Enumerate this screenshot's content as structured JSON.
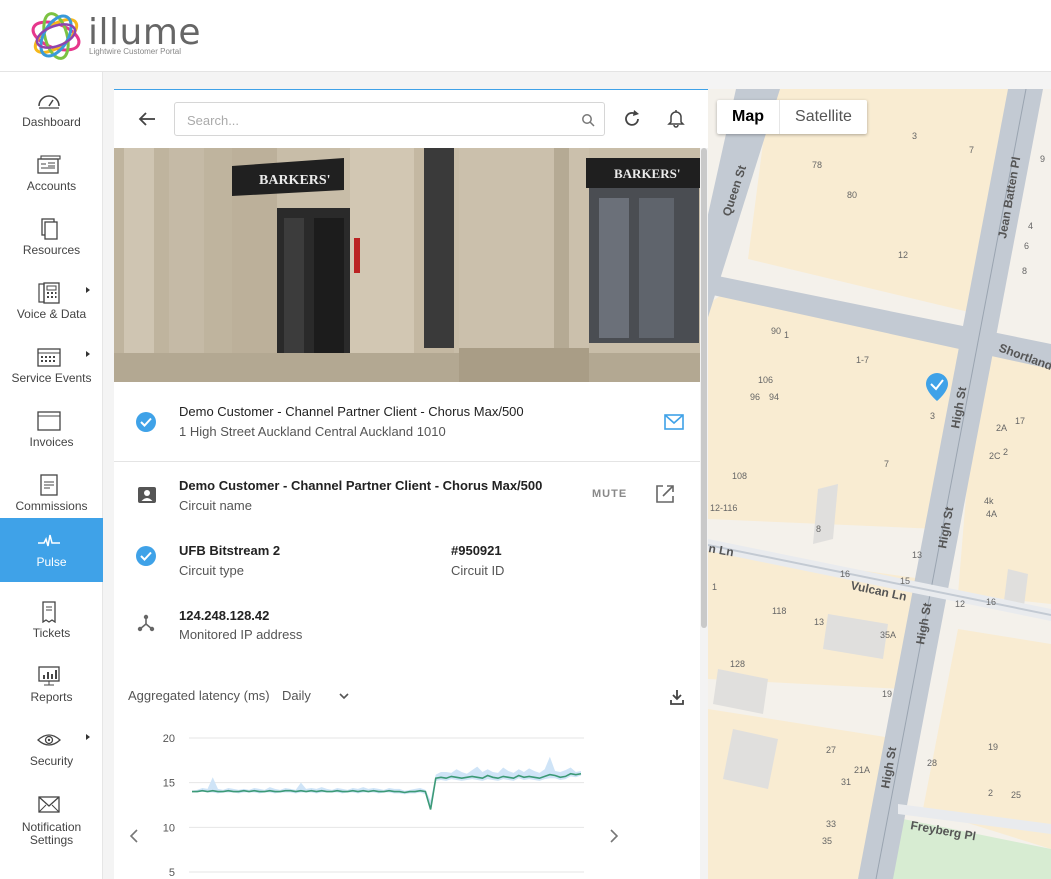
{
  "brand": {
    "name": "illume",
    "tagline": "Lightwire Customer Portal"
  },
  "nav": {
    "items": [
      {
        "label": "Dashboard"
      },
      {
        "label": "Accounts"
      },
      {
        "label": "Resources"
      },
      {
        "label": "Voice & Data"
      },
      {
        "label": "Service Events"
      },
      {
        "label": "Invoices"
      },
      {
        "label": "Commissions"
      },
      {
        "label": "Pulse"
      },
      {
        "label": "Tickets"
      },
      {
        "label": "Reports"
      },
      {
        "label": "Security"
      },
      {
        "label": "Notification",
        "label2": "Settings"
      }
    ],
    "active": "Pulse"
  },
  "search": {
    "placeholder": "Search..."
  },
  "location": {
    "name": "Demo Customer - Channel Partner Client - Chorus Max/500",
    "address": "1 High Street Auckland Central Auckland 1010"
  },
  "circuit": {
    "name": "Demo Customer - Channel Partner Client - Chorus Max/500",
    "name_label": "Circuit name",
    "mute_label": "MUTE",
    "type": "UFB Bitstream 2",
    "type_label": "Circuit type",
    "id": "#950921",
    "id_label": "Circuit ID",
    "ip": "124.248.128.42",
    "ip_label": "Monitored IP address"
  },
  "chart_section": {
    "title": "Aggregated latency (ms)",
    "period": "Daily"
  },
  "chart_data": {
    "type": "line",
    "title": "Aggregated latency (ms)",
    "ylim": [
      5,
      20
    ],
    "yticks": [
      20,
      15,
      10,
      5
    ],
    "series": [
      {
        "values": [
          14.0,
          14.0,
          14.1,
          14.0,
          14.1,
          14.0,
          14.0,
          14.1,
          14.0,
          14.0,
          14.1,
          14.0,
          14.1,
          14.0,
          14.0,
          14.1,
          14.0,
          14.0,
          14.1,
          14.1,
          14.0,
          14.1,
          14.0,
          14.1,
          14.0,
          14.1,
          14.0,
          14.0,
          14.1,
          14.0,
          14.0,
          14.1,
          14.0,
          14.1,
          14.0,
          14.1,
          14.0,
          14.0,
          14.1,
          14.0,
          14.0,
          13.9,
          14.0,
          14.0,
          14.1,
          14.0,
          12.0,
          15.5,
          15.6,
          15.5,
          15.7,
          15.6,
          15.5,
          15.6,
          15.7,
          15.6,
          15.5,
          15.8,
          15.6,
          15.5,
          15.7,
          15.6,
          15.5,
          15.8,
          15.6,
          15.7,
          15.6,
          15.5,
          15.7,
          15.9,
          15.8,
          15.6,
          15.7,
          16.0,
          15.9,
          16.0
        ]
      }
    ],
    "band_upper": [
      14.1,
      14.2,
      14.4,
      14.3,
      15.6,
      14.3,
      14.2,
      14.4,
      14.3,
      14.2,
      14.3,
      14.2,
      14.4,
      14.3,
      14.2,
      14.5,
      14.3,
      14.2,
      14.4,
      14.3,
      14.2,
      15.0,
      14.3,
      14.4,
      14.3,
      14.5,
      14.3,
      14.2,
      14.4,
      14.3,
      14.2,
      14.4,
      14.3,
      14.5,
      14.3,
      14.4,
      14.3,
      14.2,
      14.4,
      14.3,
      14.3,
      14.1,
      14.2,
      14.3,
      14.4,
      14.2,
      13.0,
      15.9,
      16.2,
      16.2,
      16.1,
      16.5,
      16.2,
      16.0,
      16.4,
      16.8,
      16.2,
      16.5,
      16.2,
      16.1,
      16.7,
      16.3,
      16.1,
      16.5,
      16.2,
      16.6,
      16.3,
      16.1,
      16.5,
      17.9,
      16.3,
      16.2,
      16.4,
      16.7,
      16.2,
      16.3
    ],
    "band_lower": [
      13.9,
      13.9,
      14.0,
      13.9,
      13.9,
      13.8,
      13.9,
      13.9,
      13.9,
      13.8,
      13.9,
      13.9,
      13.9,
      13.8,
      13.9,
      13.9,
      13.8,
      13.9,
      13.9,
      13.9,
      13.8,
      13.9,
      13.9,
      13.9,
      13.8,
      13.9,
      13.9,
      13.9,
      13.9,
      13.8,
      13.9,
      13.9,
      13.8,
      13.9,
      13.9,
      13.9,
      13.8,
      13.9,
      13.9,
      13.8,
      13.8,
      13.7,
      13.8,
      13.8,
      13.9,
      13.7,
      12.0,
      15.2,
      15.3,
      15.2,
      15.4,
      15.3,
      15.2,
      15.3,
      15.4,
      15.3,
      15.2,
      15.4,
      15.3,
      15.2,
      15.4,
      15.3,
      15.2,
      15.5,
      15.3,
      15.4,
      15.3,
      15.2,
      15.4,
      15.5,
      15.5,
      15.3,
      15.4,
      15.7,
      15.6,
      15.8
    ],
    "grid": true,
    "colors": {
      "line": "#3c9a77",
      "band": "#cfe4f7"
    }
  },
  "map": {
    "tabs": [
      "Map",
      "Satellite"
    ],
    "streets": [
      "Queen St",
      "Jean Batten Pl",
      "Shortland",
      "High St",
      "High St",
      "High St",
      "High St",
      "Vulcan Ln",
      "n Ln",
      "Freyberg Pl"
    ],
    "numbers": [
      "3",
      "7",
      "78",
      "80",
      "12",
      "90",
      "1",
      "1-7",
      "106",
      "96",
      "94",
      "3",
      "2A",
      "17",
      "2C",
      "2",
      "7",
      "108",
      "12-116",
      "8",
      "4k",
      "4A",
      "13",
      "16",
      "15",
      "12",
      "16",
      "1",
      "118",
      "13",
      "35A",
      "128",
      "19",
      "27",
      "21A",
      "31",
      "28",
      "19",
      "2",
      "25",
      "33",
      "35",
      "1",
      "9",
      "4",
      "6",
      "8",
      "15"
    ],
    "colors": {
      "pin": "#3fa2e8",
      "road": "#c3cad3",
      "block": "#f9ecd2",
      "park": "#d7ecd2"
    }
  }
}
